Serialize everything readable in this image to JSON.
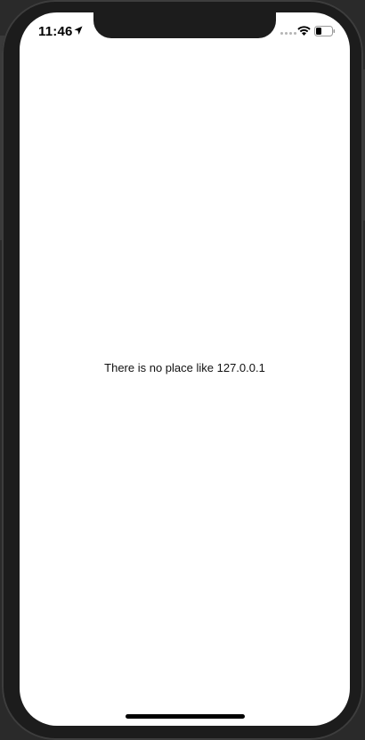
{
  "status_bar": {
    "time": "11:46",
    "icons": [
      "location-arrow-icon",
      "cellular-signal-icon",
      "wifi-icon",
      "battery-icon"
    ]
  },
  "main": {
    "message": "There is no place like 127.0.0.1"
  },
  "colors": {
    "frame": "#1c1c1c",
    "screen": "#ffffff",
    "text": "#111111"
  }
}
